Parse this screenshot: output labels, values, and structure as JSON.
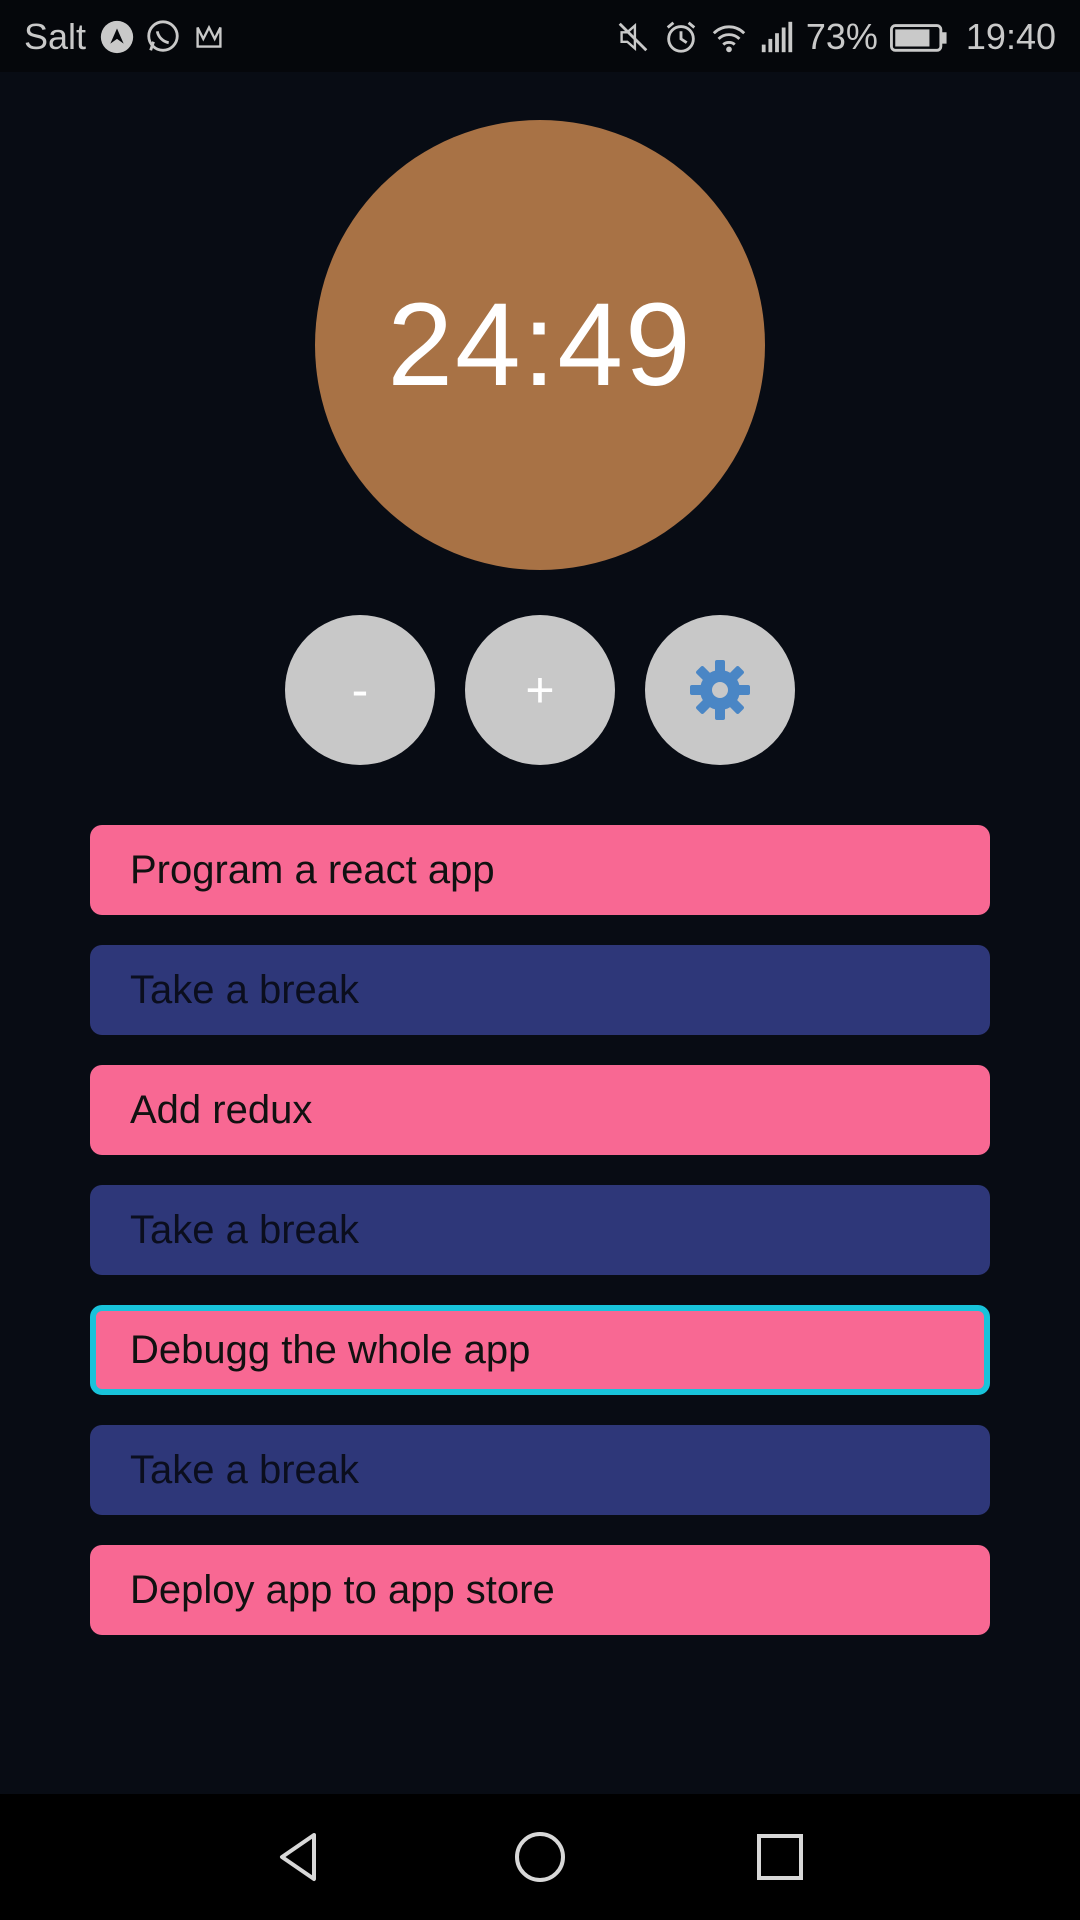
{
  "status_bar": {
    "carrier": "Salt",
    "battery_percent": "73%",
    "time": "19:40",
    "icons": [
      "navigation-icon",
      "whatsapp-icon",
      "gmail-icon",
      "mute-icon",
      "alarm-icon",
      "wifi-icon",
      "signal-icon",
      "battery-icon"
    ]
  },
  "timer": {
    "display": "24:49",
    "color": "#a87245"
  },
  "controls": {
    "minus_label": "-",
    "plus_label": "+",
    "settings_icon": "gear-icon",
    "settings_icon_color": "#4a86c5"
  },
  "tasks": [
    {
      "label": "Program a react app",
      "type": "work",
      "active": false
    },
    {
      "label": "Take a break",
      "type": "break",
      "active": false
    },
    {
      "label": "Add redux",
      "type": "work",
      "active": false
    },
    {
      "label": "Take a break",
      "type": "break",
      "active": false
    },
    {
      "label": "Debugg the whole app",
      "type": "work",
      "active": true
    },
    {
      "label": "Take a break",
      "type": "break",
      "active": false
    },
    {
      "label": "Deploy app to app store",
      "type": "work",
      "active": false
    }
  ],
  "colors": {
    "work": "#f86893",
    "break": "#2e3779",
    "active_border": "#18c3da",
    "background": "#080c14"
  },
  "nav_bar": {
    "icons": [
      "back-icon",
      "home-icon",
      "recents-icon"
    ]
  }
}
